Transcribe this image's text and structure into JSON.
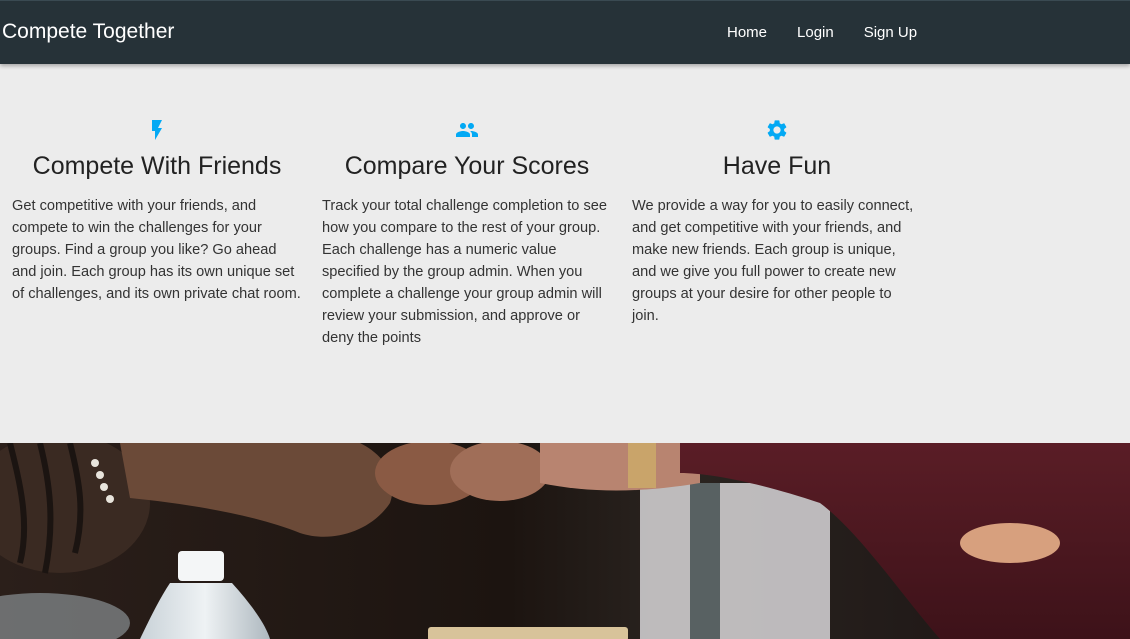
{
  "navbar": {
    "brand": "Compete Together",
    "links": [
      "Home",
      "Login",
      "Sign Up"
    ]
  },
  "features": [
    {
      "icon": "lightning-bolt-icon",
      "title": "Compete With Friends",
      "text": "Get competitive with your friends, and compete to win the challenges for your groups. Find a group you like? Go ahead and join. Each group has its own unique set of challenges, and its own private chat room."
    },
    {
      "icon": "people-icon",
      "title": "Compare Your Scores",
      "text": "Track your total challenge completion to see how you compare to the rest of your group. Each challenge has a numeric value specified by the group admin. When you complete a challenge your group admin will review your submission, and approve or deny the points"
    },
    {
      "icon": "gear-icon",
      "title": "Have Fun",
      "text": "We provide a way for you to easily connect, and get competitive with your friends, and make new friends. Each group is unique, and we give you full power to create new groups at your desire for other people to join."
    }
  ],
  "colors": {
    "navbar": "#263238",
    "accent": "#03a9f4",
    "background": "#ececec"
  },
  "hero_image": "fist-bump-photo"
}
